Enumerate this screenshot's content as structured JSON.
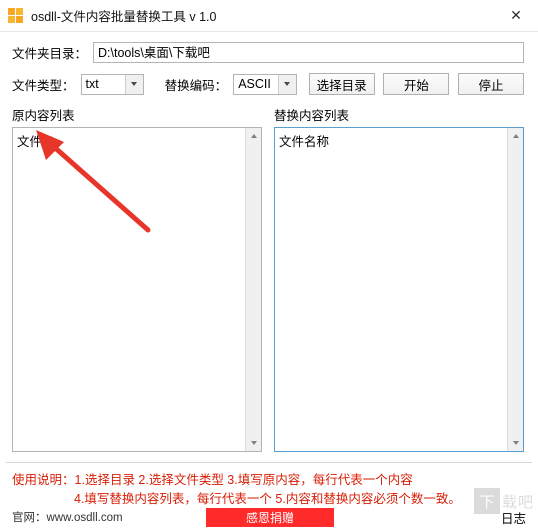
{
  "window": {
    "title": "osdll-文件内容批量替换工具 v 1.0",
    "minimize": "—",
    "maximize": "☐",
    "close": "✕"
  },
  "form": {
    "dir_label": "文件夹目录：",
    "dir_value": "D:\\tools\\桌面\\下载吧",
    "dir_placeholder": "",
    "filetype_label": "文件类型：",
    "filetype_value": "txt",
    "encoding_label": "替换编码：",
    "encoding_value": "ASCII",
    "select_dir_button": "选择目录",
    "start_button": "开始",
    "stop_button": "停止"
  },
  "lists": {
    "source_caption": "原内容列表",
    "source_item": "文件名",
    "target_caption": "替换内容列表",
    "target_item": "文件名称"
  },
  "usage": {
    "title": "使用说明：",
    "line1": "1.选择目录   2.选择文件类型   3.填写原内容，每行代表一个内容",
    "line2": "4.填写替换内容列表，每行代表一个  5.内容和替换内容必须个数一致。"
  },
  "footer": {
    "official_label": "官网：",
    "official_url": "www.osdll.com",
    "donate_button": "感恩捐赠",
    "log_label": "日志"
  },
  "watermark": {
    "mark": "下",
    "text": "载吧"
  },
  "colors": {
    "accent_red": "#d81e06",
    "donate_red": "#ff2b2b",
    "icon_orange": "#f5a623",
    "focus_blue": "#5a9fd4"
  }
}
